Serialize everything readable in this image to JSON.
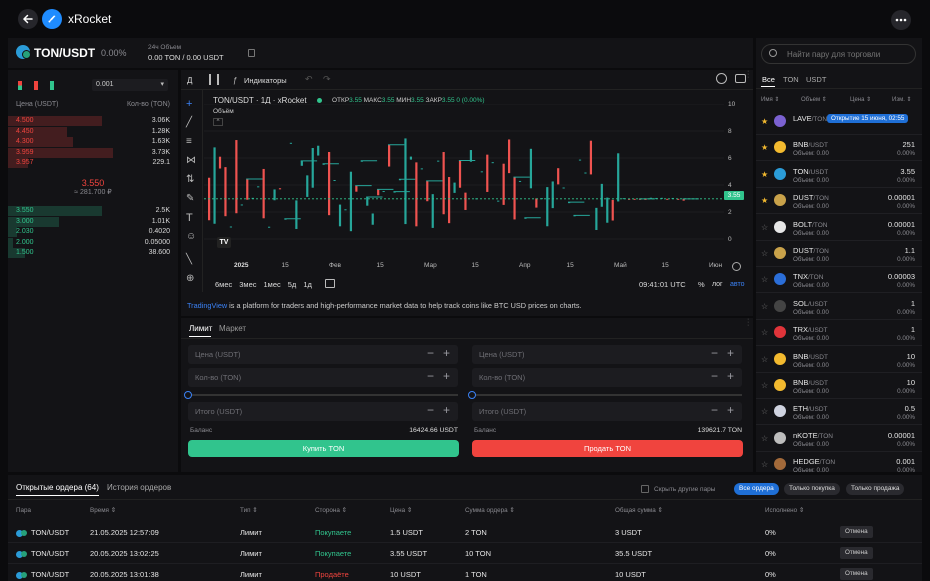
{
  "app": {
    "title": "xRocket"
  },
  "pair": {
    "name": "TON/USDT",
    "change": "0.00%",
    "volume_label": "24ч Объем",
    "volume_value": "0.00 TON / 0.00 USDT"
  },
  "orderbook": {
    "size_select": "0.001",
    "col_price": "Цена (USDT)",
    "col_qty": "Кол-во (TON)",
    "asks": [
      {
        "price": "4.500",
        "qty": "3.06K",
        "fill": 0.55
      },
      {
        "price": "4.450",
        "qty": "1.28K",
        "fill": 0.35
      },
      {
        "price": "4.300",
        "qty": "1.63K",
        "fill": 0.38
      },
      {
        "price": "3.959",
        "qty": "3.73K",
        "fill": 0.62
      },
      {
        "price": "3.957",
        "qty": "229.1",
        "fill": 0.12
      }
    ],
    "mid_price": "3.550",
    "mid_fiat": "≈ 281.700 ₽",
    "bids": [
      {
        "price": "3.550",
        "qty": "2.5K",
        "fill": 0.55
      },
      {
        "price": "3.000",
        "qty": "1.01K",
        "fill": 0.3
      },
      {
        "price": "2.030",
        "qty": "0.4020",
        "fill": 0.05
      },
      {
        "price": "2.000",
        "qty": "0.05000",
        "fill": 0.03
      },
      {
        "price": "1.500",
        "qty": "38.600",
        "fill": 0.1
      }
    ]
  },
  "chart": {
    "interval_label": "Д",
    "indicators_label": "Индикаторы",
    "symbol_line": "TON/USDT · 1Д · xRocket",
    "ohlc": {
      "o_label": "ОТКР",
      "o": "3.55",
      "h_label": "МАКС",
      "h": "3.55",
      "l_label": "МИН",
      "l": "3.55",
      "c_label": "ЗАКР",
      "c": "3.55",
      "chg": "0 (0.00%)"
    },
    "volume_label": "Объём",
    "price_tag": "3.55",
    "y_ticks": [
      "10",
      "8",
      "6",
      "4",
      "2",
      "0"
    ],
    "x_ticks": [
      "2025",
      "15",
      "Фев",
      "15",
      "Мар",
      "15",
      "Апр",
      "15",
      "Май",
      "15",
      "Июн"
    ],
    "ranges": [
      "6мес",
      "3мес",
      "1мес",
      "5д",
      "1д"
    ],
    "time": "09:41:01 UTC",
    "pct": "%",
    "log": "лог",
    "auto": "авто",
    "tv_link": "TradingView",
    "tv_text": " is a platform for traders and high-performance market data to help track coins like BTC USD prices on charts.",
    "chart_data": {
      "type": "line",
      "x": [
        "2025",
        "Фев",
        "Мар",
        "Апр",
        "Май",
        "Июн"
      ],
      "ylim": [
        0,
        11
      ],
      "series": [
        {
          "values": [
            3.55,
            3.55,
            3.55,
            3.55,
            3.55,
            3.55
          ]
        }
      ]
    }
  },
  "form": {
    "tabs": [
      "Лимит",
      "Маркет"
    ],
    "buy": {
      "price_ph": "Цена (USDT)",
      "qty_ph": "Кол-во (TON)",
      "total_ph": "Итого (USDT)",
      "balance_label": "Баланс",
      "balance": "16424.66 USDT",
      "button": "Купить TON"
    },
    "sell": {
      "price_ph": "Цена (USDT)",
      "qty_ph": "Кол-во (TON)",
      "total_ph": "Итого (USDT)",
      "balance_label": "Баланс",
      "balance": "139621.7 TON",
      "button": "Продать TON"
    }
  },
  "sidebar": {
    "search_placeholder": "Найти пару для торговли",
    "tabs": [
      "Все",
      "TON",
      "USDT"
    ],
    "cols": [
      "Имя",
      "Объем",
      "Цена",
      "Изм."
    ],
    "tooltip": "Открытие 15 июня, 02:55",
    "vol_label": "Объем: 0.00",
    "items": [
      {
        "base": "LAVE",
        "quote": "/TON",
        "price": "",
        "chg": "",
        "star": true,
        "color": "#7b61d1"
      },
      {
        "base": "BNB",
        "quote": "/USDT",
        "price": "251",
        "chg": "0.00%",
        "star": true,
        "color": "#f3ba2f"
      },
      {
        "base": "TON",
        "quote": "/USDT",
        "price": "3.55",
        "chg": "0.00%",
        "star": true,
        "color": "#2b9cd8"
      },
      {
        "base": "DUST",
        "quote": "/TON",
        "price": "0.00001",
        "chg": "0.00%",
        "star": true,
        "color": "#c9a24a"
      },
      {
        "base": "BOLT",
        "quote": "/TON",
        "price": "0.00001",
        "chg": "0.00%",
        "star": false,
        "color": "#e6e6e6"
      },
      {
        "base": "DUST",
        "quote": "/TON",
        "price": "1.1",
        "chg": "0.00%",
        "star": false,
        "color": "#c9a24a"
      },
      {
        "base": "TNX",
        "quote": "/TON",
        "price": "0.00003",
        "chg": "0.00%",
        "star": false,
        "color": "#2b6ed8"
      },
      {
        "base": "SOL",
        "quote": "/USDT",
        "price": "1",
        "chg": "0.00%",
        "star": false,
        "color": "#444"
      },
      {
        "base": "TRX",
        "quote": "/USDT",
        "price": "1",
        "chg": "0.00%",
        "star": false,
        "color": "#e0343a"
      },
      {
        "base": "BNB",
        "quote": "/USDT",
        "price": "10",
        "chg": "0.00%",
        "star": false,
        "color": "#f3ba2f"
      },
      {
        "base": "BNB",
        "quote": "/USDT",
        "price": "10",
        "chg": "0.00%",
        "star": false,
        "color": "#f3ba2f"
      },
      {
        "base": "ETH",
        "quote": "/USDT",
        "price": "0.5",
        "chg": "0.00%",
        "star": false,
        "color": "#cfd3e0"
      },
      {
        "base": "nKOTE",
        "quote": "/TON",
        "price": "0.00001",
        "chg": "0.00%",
        "star": false,
        "color": "#bdbdbd"
      },
      {
        "base": "HEDGE",
        "quote": "/TON",
        "price": "0.001",
        "chg": "0.00%",
        "star": false,
        "color": "#a36a3a"
      }
    ]
  },
  "orders": {
    "tab_open": "Открытые ордера",
    "tab_open_count": "(64)",
    "tab_history": "История ордеров",
    "hide_label": "Скрыть другие пары",
    "filters": [
      "Все ордера",
      "Только покупка",
      "Только продажа"
    ],
    "cols": [
      "Пара",
      "Время",
      "Тип",
      "Сторона",
      "Цена",
      "Сумма ордера",
      "Общая сумма",
      "Исполнено"
    ],
    "rows": [
      {
        "pair": "TON/USDT",
        "time": "21.05.2025 12:57:09",
        "type": "Лимит",
        "side": "Покупаете",
        "side_kind": "buy",
        "price": "1.5 USDT",
        "amount": "2 TON",
        "total": "3 USDT",
        "filled": "0%",
        "cancel": "Отмена"
      },
      {
        "pair": "TON/USDT",
        "time": "20.05.2025 13:02:25",
        "type": "Лимит",
        "side": "Покупаете",
        "side_kind": "buy",
        "price": "3.55 USDT",
        "amount": "10 TON",
        "total": "35.5 USDT",
        "filled": "0%",
        "cancel": "Отмена"
      },
      {
        "pair": "TON/USDT",
        "time": "20.05.2025 13:01:38",
        "type": "Лимит",
        "side": "Продаёте",
        "side_kind": "sell",
        "price": "10 USDT",
        "amount": "1 TON",
        "total": "10 USDT",
        "filled": "0%",
        "cancel": "Отмена"
      }
    ]
  }
}
